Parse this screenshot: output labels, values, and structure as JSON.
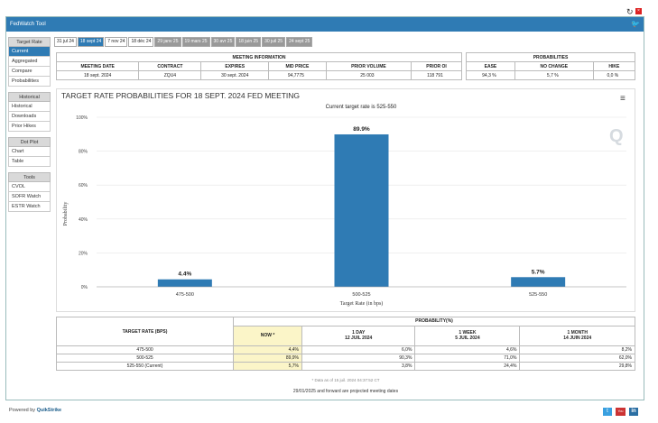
{
  "window": {
    "title": "FedWatch Tool"
  },
  "sidebar": [
    {
      "head": "Target Rate",
      "items": [
        {
          "label": "Current",
          "active": true
        },
        {
          "label": "Aggregated"
        },
        {
          "label": "Compare"
        },
        {
          "label": "Probabilities"
        }
      ]
    },
    {
      "head": "Historical",
      "items": [
        {
          "label": "Historical"
        },
        {
          "label": "Downloads"
        },
        {
          "label": "Prior Hikes"
        }
      ]
    },
    {
      "head": "Dot Plot",
      "items": [
        {
          "label": "Chart"
        },
        {
          "label": "Table"
        }
      ]
    },
    {
      "head": "Tools",
      "items": [
        {
          "label": "CVOL"
        },
        {
          "label": "SOFR Watch"
        },
        {
          "label": "ESTR Watch"
        }
      ]
    }
  ],
  "tabs": [
    {
      "label": "31 jul 24",
      "state": "normal"
    },
    {
      "label": "18 sept 24",
      "state": "active"
    },
    {
      "label": "7 nov 24",
      "state": "normal"
    },
    {
      "label": "18 déc 24",
      "state": "normal"
    },
    {
      "label": "29 janv 25",
      "state": "grey"
    },
    {
      "label": "19 mars 25",
      "state": "grey"
    },
    {
      "label": "30 avr 25",
      "state": "grey"
    },
    {
      "label": "18 juin 25",
      "state": "grey"
    },
    {
      "label": "30 juil 25",
      "state": "grey"
    },
    {
      "label": "24 sept 25",
      "state": "grey"
    }
  ],
  "meeting_info": {
    "header": "MEETING INFORMATION",
    "columns": [
      "MEETING DATE",
      "CONTRACT",
      "EXPIRES",
      "MID PRICE",
      "PRIOR VOLUME",
      "PRIOR OI"
    ],
    "values": [
      "18 sept. 2024",
      "ZQU4",
      "30 sept. 2024",
      "94,7775",
      "25 003",
      "118 791"
    ]
  },
  "probabilities": {
    "header": "PROBABILITIES",
    "columns": [
      "EASE",
      "NO CHANGE",
      "HIKE"
    ],
    "values": [
      "94,3 %",
      "5,7 %",
      "0,0 %"
    ]
  },
  "chart_title": "TARGET RATE PROBABILITIES FOR 18 SEPT. 2024 FED MEETING",
  "chart_data": {
    "type": "bar",
    "subtitle": "Current target rate is 525-550",
    "categories": [
      "475-500",
      "500-525",
      "525-550"
    ],
    "values": [
      4.4,
      89.9,
      5.7
    ],
    "data_labels": [
      "4.4%",
      "89.9%",
      "5.7%"
    ],
    "xlabel": "Target Rate (in bps)",
    "ylabel": "Probability",
    "ylim": [
      0,
      100
    ],
    "yticks": [
      "0%",
      "20%",
      "40%",
      "60%",
      "80%",
      "100%"
    ],
    "bar_color": "#2f7bb4"
  },
  "bottom_table": {
    "col1_header": "TARGET RATE (BPS)",
    "prob_header": "PROBABILITY(%)",
    "sub_headers": [
      {
        "line1": "NOW *",
        "line2": ""
      },
      {
        "line1": "1 DAY",
        "line2": "12 JUIL 2024"
      },
      {
        "line1": "1 WEEK",
        "line2": "5 JUIL 2024"
      },
      {
        "line1": "1 MONTH",
        "line2": "14 JUIN 2024"
      }
    ],
    "rows": [
      {
        "rate": "475-500",
        "now": "4,4%",
        "d1": "6,0%",
        "w1": "4,6%",
        "m1": "8,2%"
      },
      {
        "rate": "500-525",
        "now": "89,9%",
        "d1": "90,3%",
        "w1": "71,0%",
        "m1": "62,0%"
      },
      {
        "rate": "525-550 (Current)",
        "now": "5,7%",
        "d1": "3,8%",
        "w1": "24,4%",
        "m1": "29,8%"
      }
    ]
  },
  "notes": {
    "data_as_of": "* Data as of 15 juil. 2024 04:37:52 CT",
    "projected": "29/01/2025 and forward are projected meeting dates"
  },
  "footer": {
    "powered_by": "Powered by",
    "brand": "QuikStrike"
  }
}
